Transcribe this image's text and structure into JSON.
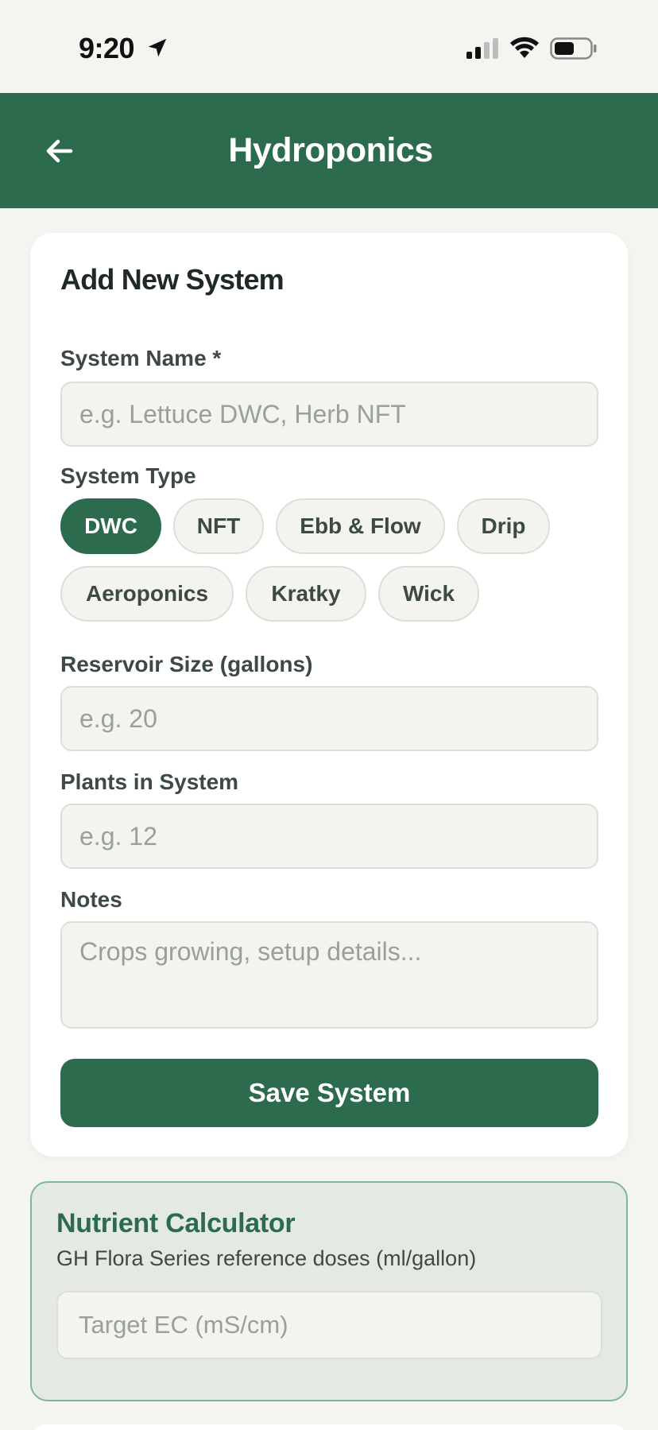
{
  "status_bar": {
    "time": "9:20",
    "icons": [
      "location-arrow-icon",
      "signal-icon",
      "wifi-icon",
      "battery-icon"
    ]
  },
  "header": {
    "title": "Hydroponics",
    "back_icon": "arrow-left-icon"
  },
  "form": {
    "title": "Add New System",
    "system_name": {
      "label": "System Name *",
      "placeholder": "e.g. Lettuce DWC, Herb NFT",
      "value": ""
    },
    "system_type": {
      "label": "System Type",
      "selected": "DWC",
      "options": [
        "DWC",
        "NFT",
        "Ebb & Flow",
        "Drip",
        "Aeroponics",
        "Kratky",
        "Wick"
      ]
    },
    "reservoir": {
      "label": "Reservoir Size (gallons)",
      "placeholder": "e.g. 20",
      "value": ""
    },
    "plants": {
      "label": "Plants in System",
      "placeholder": "e.g. 12",
      "value": ""
    },
    "notes": {
      "label": "Notes",
      "placeholder": "Crops growing, setup details...",
      "value": ""
    },
    "save_label": "Save System"
  },
  "calculator": {
    "title": "Nutrient Calculator",
    "subtitle": "GH Flora Series reference doses (ml/gallon)",
    "target_ec_placeholder": "Target EC (mS/cm)"
  },
  "colors": {
    "brand": "#2d6b4f",
    "background": "#f4f5f0",
    "input_bg": "#f3f4ef",
    "calc_bg": "#e4eae2",
    "calc_border": "#7fb59a"
  }
}
